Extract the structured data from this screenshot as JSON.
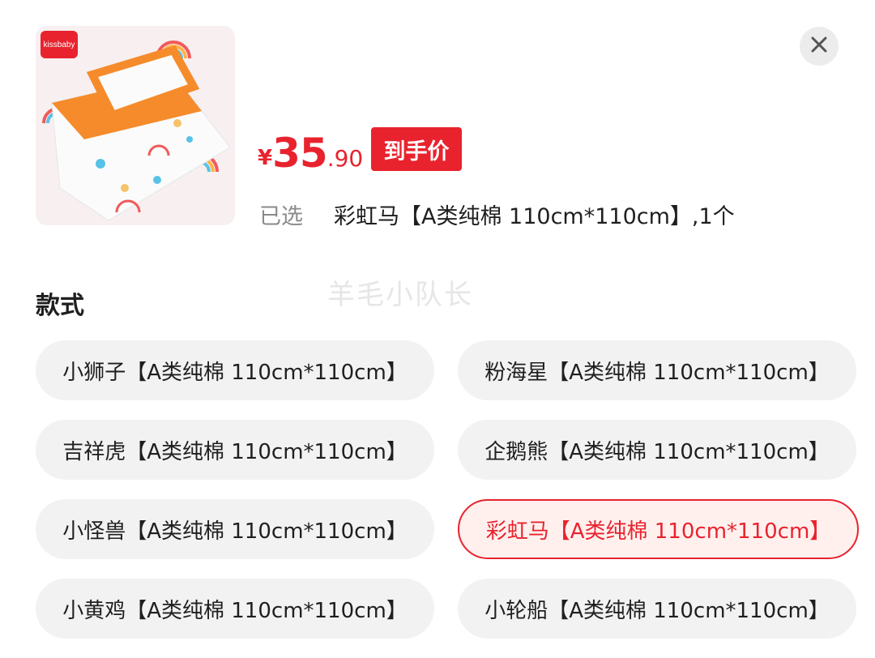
{
  "product": {
    "brand_badge": "kissbaby",
    "price_currency": "¥",
    "price_integer": "35",
    "price_decimal": ".90",
    "price_tag": "到手价",
    "selected_label": "已选",
    "selected_value": "彩虹马【A类纯棉 110cm*110cm】,1个"
  },
  "watermark": "羊毛小队长",
  "style_section": {
    "title": "款式",
    "options": [
      {
        "label": "小狮子【A类纯棉 110cm*110cm】",
        "selected": false
      },
      {
        "label": "粉海星【A类纯棉 110cm*110cm】",
        "selected": false
      },
      {
        "label": "吉祥虎【A类纯棉 110cm*110cm】",
        "selected": false
      },
      {
        "label": "企鹅熊【A类纯棉 110cm*110cm】",
        "selected": false
      },
      {
        "label": "小怪兽【A类纯棉 110cm*110cm】",
        "selected": false
      },
      {
        "label": "彩虹马【A类纯棉 110cm*110cm】",
        "selected": true
      },
      {
        "label": "小黄鸡【A类纯棉 110cm*110cm】",
        "selected": false
      },
      {
        "label": "小轮船【A类纯棉 110cm*110cm】",
        "selected": false
      }
    ]
  },
  "icons": {
    "close": "close-icon"
  },
  "colors": {
    "accent": "#e8232e",
    "option_bg": "#f2f2f2",
    "selected_bg": "#fff0ee"
  }
}
